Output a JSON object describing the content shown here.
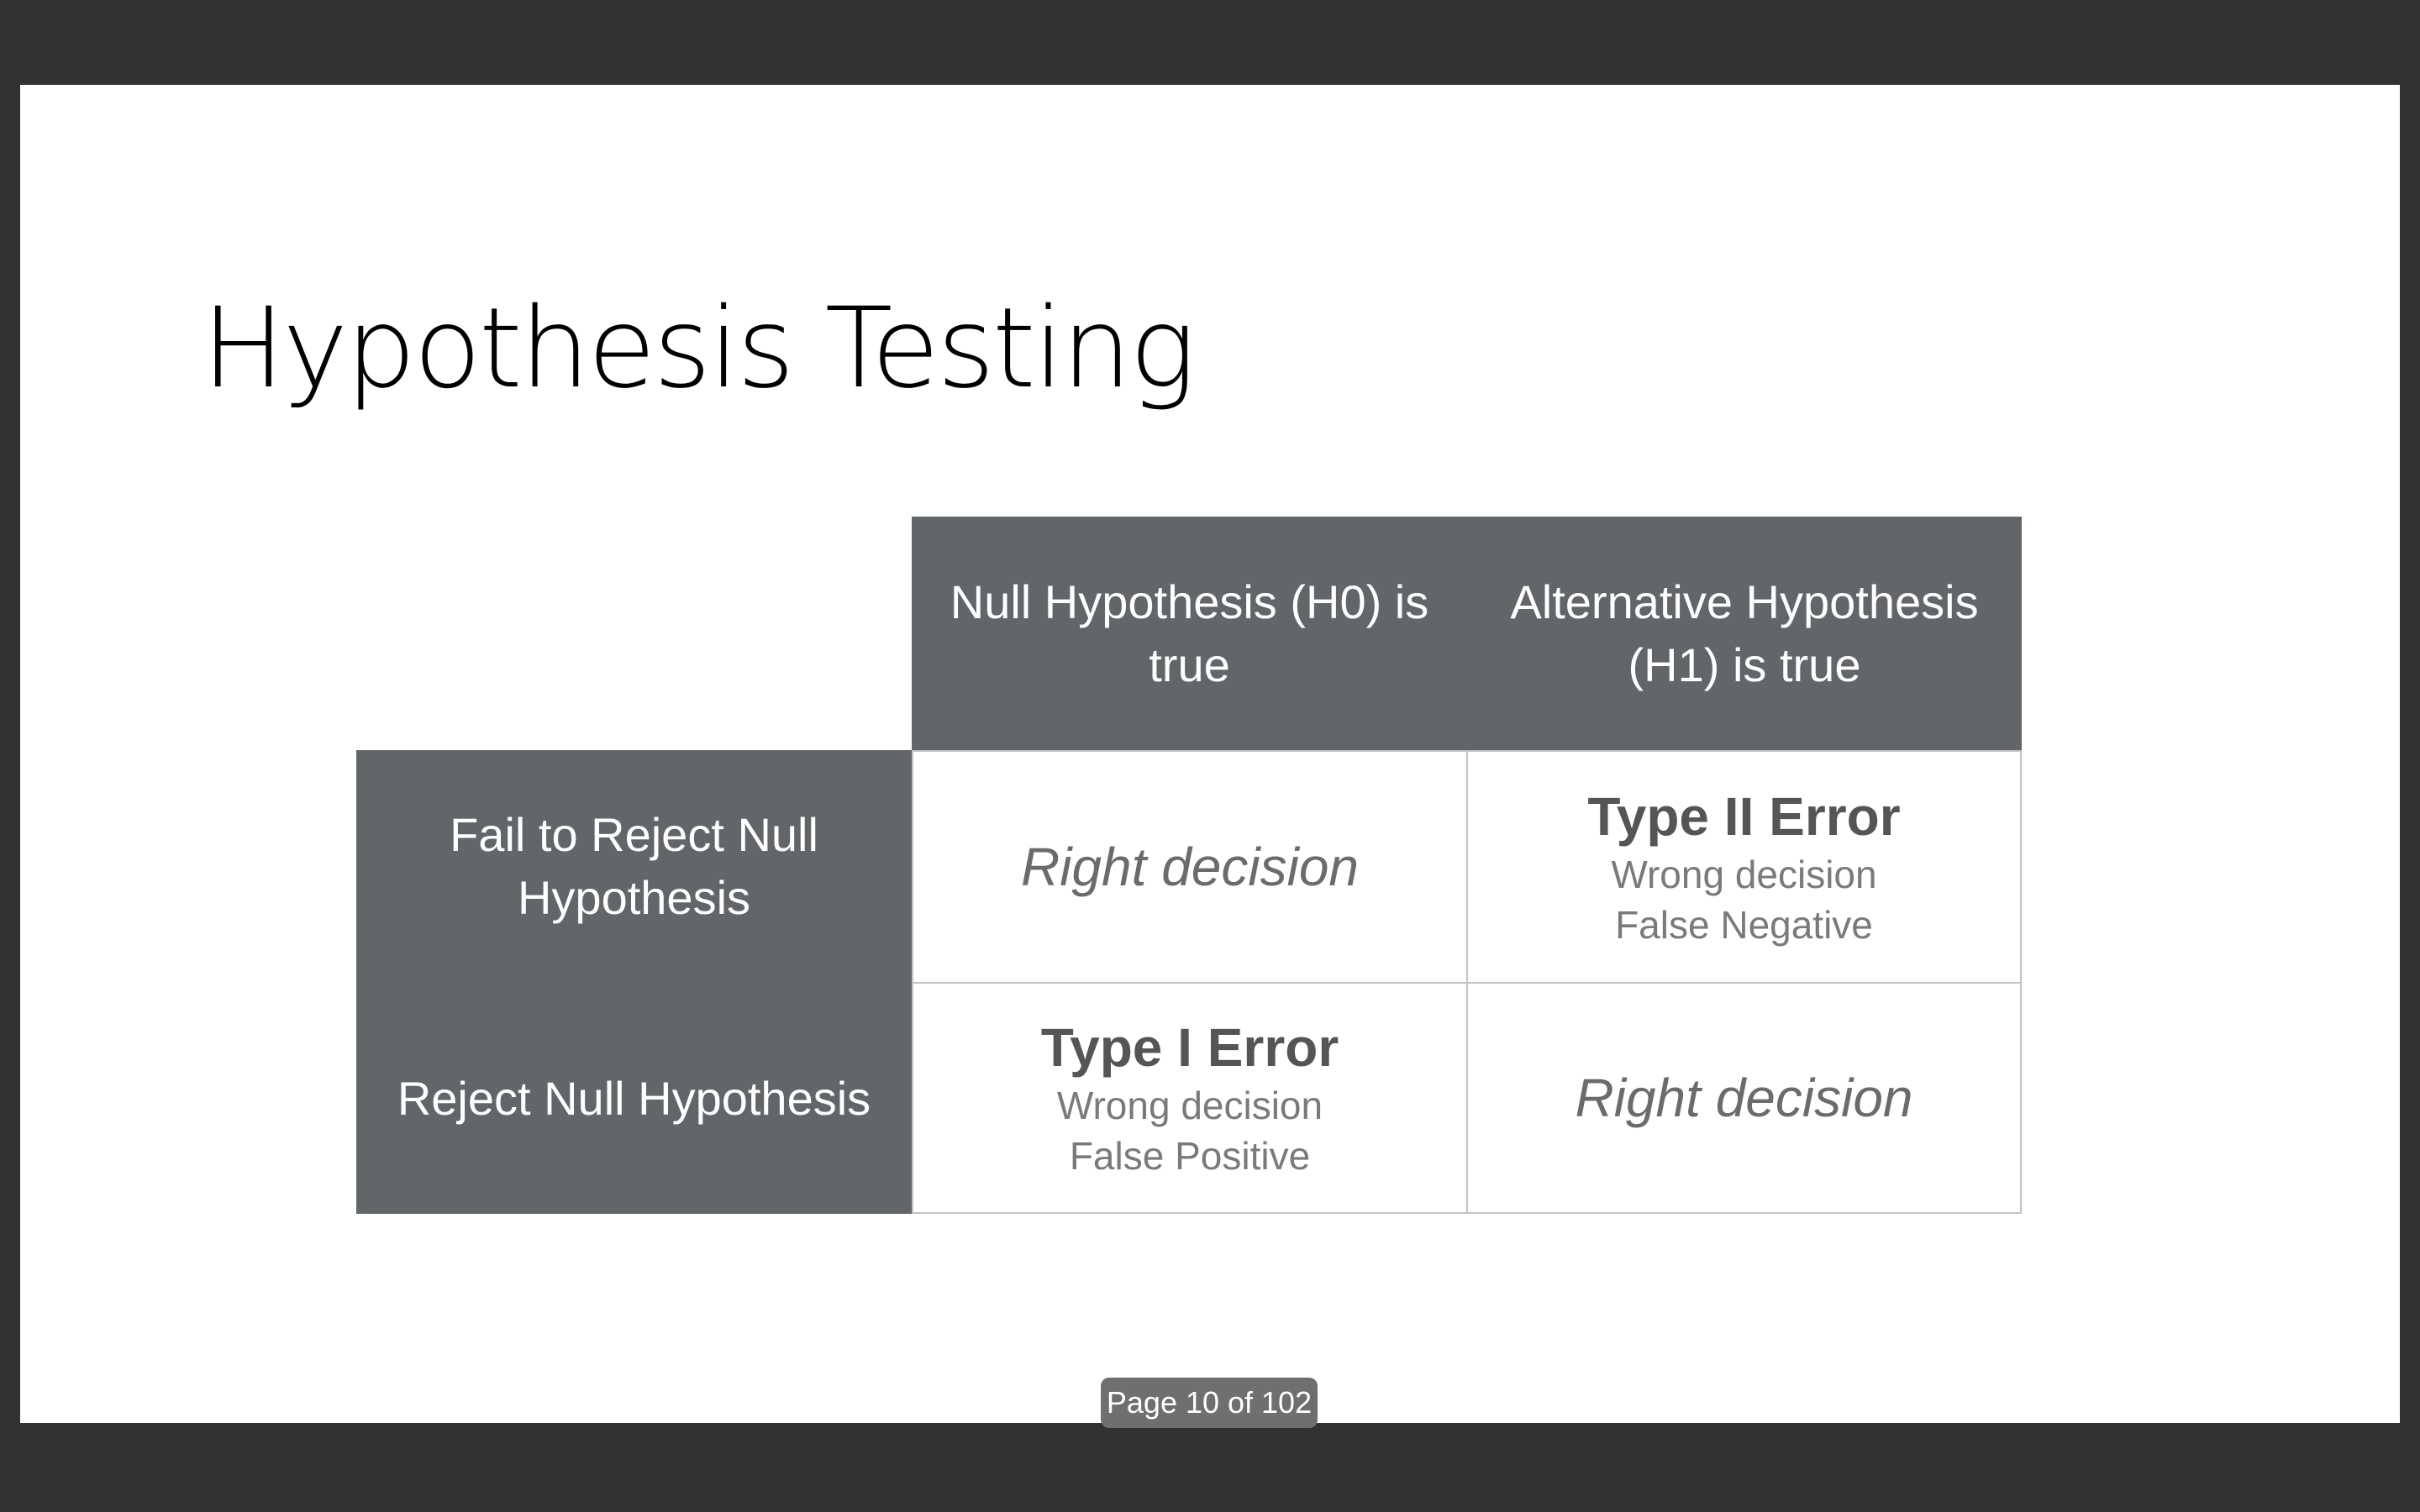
{
  "slide": {
    "title": "Hypothesis Testing"
  },
  "matrix": {
    "columns": [
      {
        "line1": "Null Hypothesis (H0) is",
        "line2": "true"
      },
      {
        "line1": "Alternative Hypothesis",
        "line2": "(H1) is true"
      }
    ],
    "rows": [
      {
        "line1": "Fail to Reject Null",
        "line2": "Hypothesis"
      },
      {
        "line1": "Reject Null Hypothesis",
        "line2": ""
      }
    ],
    "cells": {
      "r1c1": {
        "label": "Right decision"
      },
      "r1c2": {
        "title": "Type II Error",
        "sub1": "Wrong decision",
        "sub2": "False Negative"
      },
      "r2c1": {
        "title": "Type I Error",
        "sub1": "Wrong decision",
        "sub2": "False Positive"
      },
      "r2c2": {
        "label": "Right decision"
      }
    }
  },
  "viewer": {
    "page_indicator": "Page 10 of 102"
  },
  "colors": {
    "viewer_background": "#323232",
    "slide_background": "#ffffff",
    "header_fill": "#626669",
    "cell_border": "#c2c2c2"
  }
}
